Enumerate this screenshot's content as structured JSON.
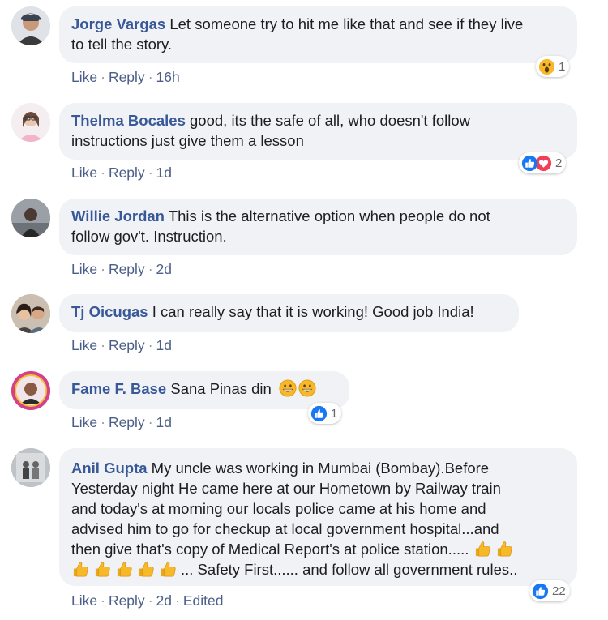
{
  "actions": {
    "like": "Like",
    "reply": "Reply",
    "edited": "Edited"
  },
  "colors": {
    "author": "#385898",
    "bubble": "#f0f2f5",
    "link": "#4b5f88",
    "like_blue": "#1877f2",
    "love_red": "#f33e58",
    "wow_yellow": "#f7b928"
  },
  "comments": [
    {
      "author": "Jorge Vargas",
      "text": "Let someone try to hit me like that and see if they live",
      "text2": "to tell the story.",
      "time": "16h",
      "reactions": "1",
      "reaction_icons": [
        "wow-icon"
      ]
    },
    {
      "author": "Thelma Bocales",
      "text": "good, its the safe of all, who doesn't follow",
      "text2": "instructions just give them a lesson",
      "time": "1d",
      "reactions": "2",
      "reaction_icons": [
        "like-icon",
        "love-icon"
      ]
    },
    {
      "author": "Willie Jordan",
      "text": "This is the alternative option when people do not",
      "text2": "follow gov't. Instruction.",
      "time": "2d"
    },
    {
      "author": "Tj Oicugas",
      "text": "I can really say that it is working! Good job India!",
      "time": "1d"
    },
    {
      "author": "Fame F. Base",
      "text": "Sana Pinas din",
      "emoji": "grinning-face-icon",
      "time": "1d",
      "reactions": "1",
      "reaction_icons": [
        "like-icon"
      ]
    },
    {
      "author": "Anil Gupta",
      "text": "My uncle was working in Mumbai (Bombay).Before",
      "line2": "Yesterday night He came here at our Hometown by Railway train",
      "line3": "and today's at morning our locals police came at his home and",
      "line4": "advised him to go for checkup at local government hospital...and",
      "line5": "then give that's copy of Medical Report's at police station.....",
      "line6": "... Safety First...... and follow all government rules..",
      "emoji": "thumbs-up-icon",
      "time": "2d",
      "reactions": "22",
      "reaction_icons": [
        "like-icon"
      ]
    }
  ]
}
